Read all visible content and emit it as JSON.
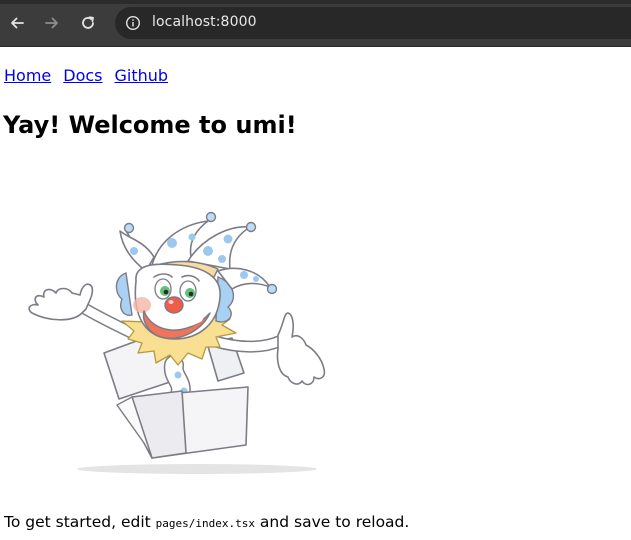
{
  "browser": {
    "url": "localhost:8000",
    "back_icon": "arrow-left-icon",
    "forward_icon": "arrow-right-icon",
    "reload_icon": "reload-icon",
    "site_info_icon": "info-icon"
  },
  "nav": {
    "links": [
      "Home",
      "Docs",
      "Github"
    ]
  },
  "page": {
    "title": "Yay! Welcome to umi!",
    "intro_before": "To get started, edit ",
    "intro_code": "pages/index.tsx",
    "intro_after": " and save to reload."
  },
  "illustration": {
    "name": "jester-in-box-illustration"
  },
  "colors": {
    "link": "#0000ee",
    "toolbar": "#3c3c3c",
    "omnibox": "#282828"
  }
}
